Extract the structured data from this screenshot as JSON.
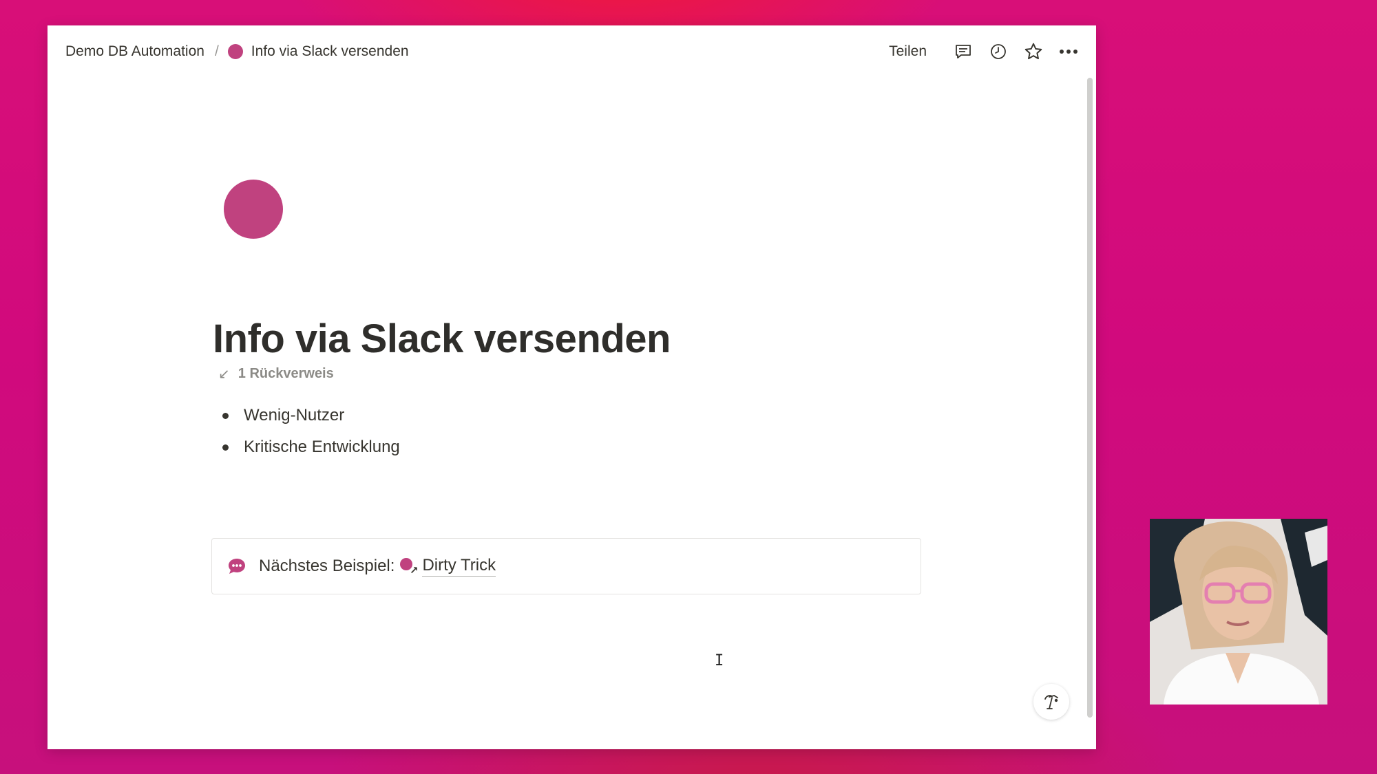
{
  "breadcrumb": {
    "workspace": "Demo DB Automation",
    "separator": "/",
    "page": "Info via Slack versenden"
  },
  "toolbar": {
    "share_label": "Teilen",
    "icons": [
      "comment-icon",
      "history-icon",
      "star-icon",
      "more-icon"
    ]
  },
  "page": {
    "icon_color": "#c0427f",
    "title": "Info via Slack versenden",
    "backlinks": "1 Rückverweis",
    "bullets": [
      "Wenig-Nutzer",
      "Kritische Entwicklung"
    ]
  },
  "callout": {
    "icon": "speech-bubble-icon",
    "text": "Nächstes Beispiel:",
    "link_label": "Dirty Trick"
  },
  "colors": {
    "accent": "#c0427f",
    "background": "#d10a7d"
  }
}
